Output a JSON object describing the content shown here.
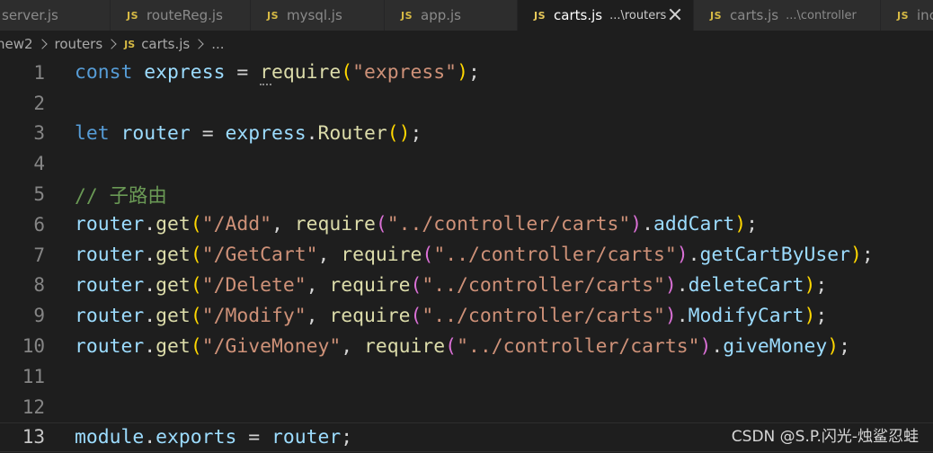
{
  "tabs": [
    {
      "label": "server.js",
      "description": ""
    },
    {
      "label": "routeReg.js",
      "description": ""
    },
    {
      "label": "mysql.js",
      "description": ""
    },
    {
      "label": "app.js",
      "description": ""
    },
    {
      "label": "carts.js",
      "description": "...\\routers"
    },
    {
      "label": "carts.js",
      "description": "...\\controller"
    },
    {
      "label": "inc",
      "description": ""
    }
  ],
  "js_badge": "JS",
  "breadcrumb": {
    "folder": "new2",
    "subfolder": "routers",
    "file": "carts.js",
    "more": "..."
  },
  "line_numbers": [
    "1",
    "2",
    "3",
    "4",
    "5",
    "6",
    "7",
    "8",
    "9",
    "10",
    "11",
    "12",
    "13"
  ],
  "code": {
    "l1": {
      "kw": "const",
      "var": "express",
      "eq": " = ",
      "fn": "require",
      "str": "\"express\""
    },
    "l3": {
      "kw": "let",
      "var": "router",
      "eq": " = ",
      "obj": "express",
      "fn": "Router"
    },
    "l5": {
      "comment": "// 子路由"
    },
    "routes": [
      {
        "path": "\"/Add\"",
        "module": "\"../controller/carts\"",
        "handler": "addCart"
      },
      {
        "path": "\"/GetCart\"",
        "module": "\"../controller/carts\"",
        "handler": "getCartByUser"
      },
      {
        "path": "\"/Delete\"",
        "module": "\"../controller/carts\"",
        "handler": "deleteCart"
      },
      {
        "path": "\"/Modify\"",
        "module": "\"../controller/carts\"",
        "handler": "ModifyCart"
      },
      {
        "path": "\"/GiveMoney\"",
        "module": "\"../controller/carts\"",
        "handler": "giveMoney"
      }
    ],
    "route_obj": "router",
    "route_method": "get",
    "require_fn": "require",
    "l13": {
      "obj": "module",
      "prop": "exports",
      "eq": " = ",
      "var": "router"
    }
  },
  "watermark": "CSDN @S.P.闪光-烛鲨忍蛙"
}
